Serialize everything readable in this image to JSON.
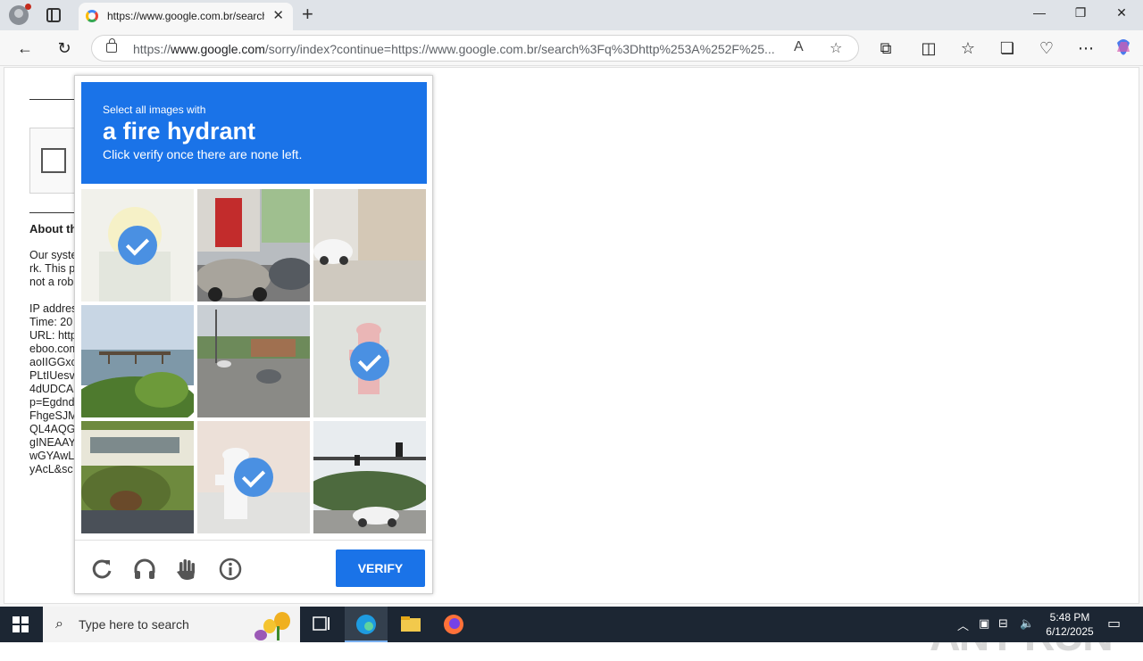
{
  "browser": {
    "tab_title": "https://www.google.com.br/search",
    "url_prefix": "https://",
    "url_host": "www.google.com",
    "url_rest": "/sorry/index?continue=https://www.google.com.br/search%3Fq%3Dhttp%253A%252F%25..."
  },
  "behind_page": {
    "title": "About th",
    "para1": "Our syste\nrk. This p\nnot a rob",
    "para2": "IP addres\nTime: 20\nURL: http\neboo.com\naoIIGGxc\nPLtIUesv\n4dUDCA\np=Egdnd\nFhgeSJM\nQL4AQG\ngINEAAY\nwGYAwL\nyAcL&sc"
  },
  "captcha": {
    "instruction_line1": "Select all images with",
    "target_object": "a fire hydrant",
    "instruction_line3": "Click verify once there are none left.",
    "verify_label": "VERIFY",
    "header_color": "#1a73e8",
    "tiles": [
      {
        "index": 1,
        "selected": true
      },
      {
        "index": 2,
        "selected": false
      },
      {
        "index": 3,
        "selected": false
      },
      {
        "index": 4,
        "selected": false
      },
      {
        "index": 5,
        "selected": false
      },
      {
        "index": 6,
        "selected": true
      },
      {
        "index": 7,
        "selected": false
      },
      {
        "index": 8,
        "selected": true
      },
      {
        "index": 9,
        "selected": false
      }
    ]
  },
  "watermark": "ANY RUN",
  "taskbar": {
    "search_placeholder": "Type here to search",
    "time": "5:48 PM",
    "date": "6/12/2025"
  }
}
